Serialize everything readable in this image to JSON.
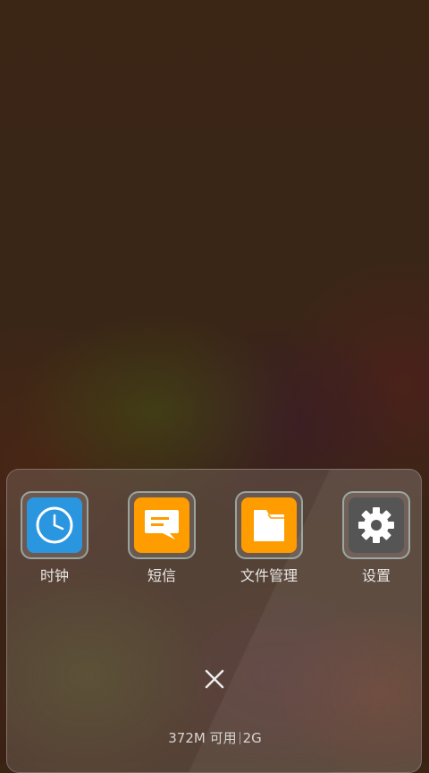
{
  "apps": [
    {
      "label": "时钟",
      "icon": "clock-icon",
      "color": "#2a96e0"
    },
    {
      "label": "短信",
      "icon": "message-icon",
      "color": "#ff9c00"
    },
    {
      "label": "文件管理",
      "icon": "folder-icon",
      "color": "#ff9c00"
    },
    {
      "label": "设置",
      "icon": "gear-icon",
      "color": "#555555"
    }
  ],
  "close_button": {
    "icon": "close-icon"
  },
  "memory": {
    "available": "372M 可用",
    "total": "2G"
  }
}
